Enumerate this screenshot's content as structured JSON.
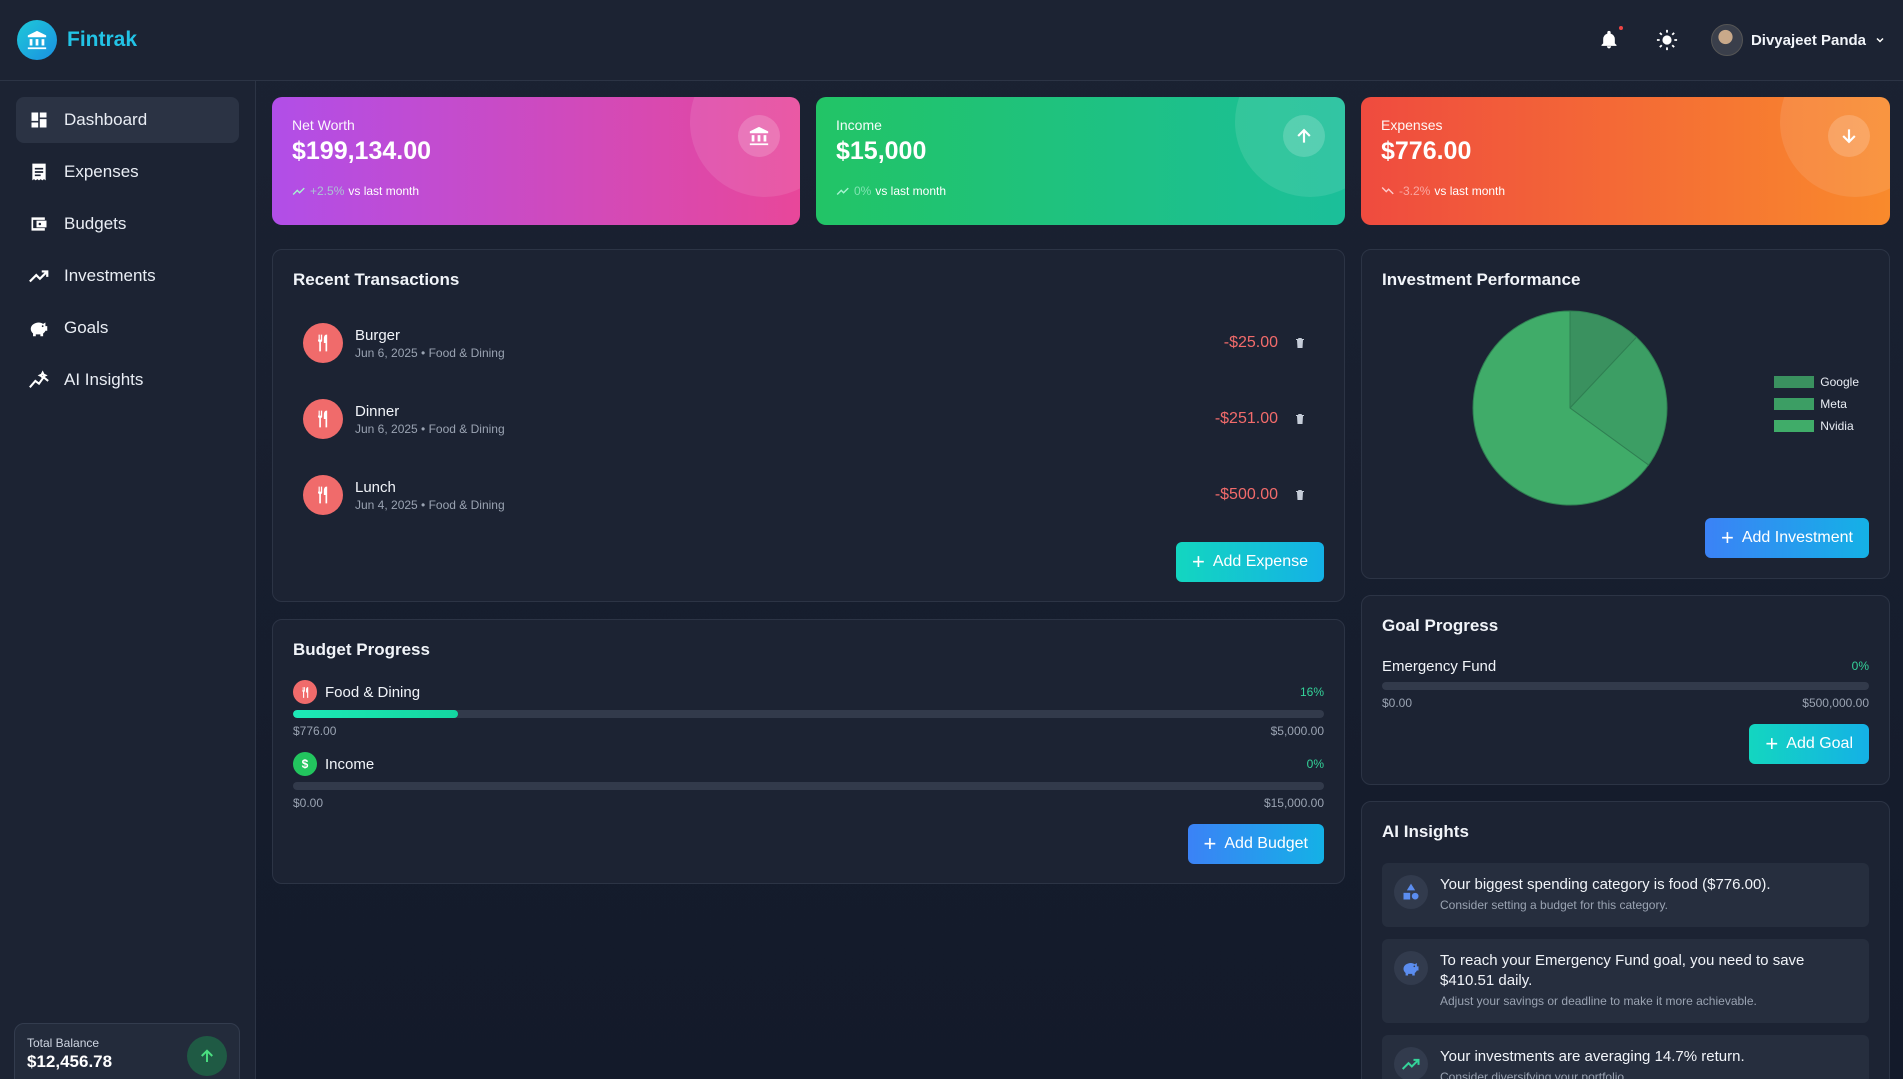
{
  "app": {
    "name": "Fintrak"
  },
  "header": {
    "user_name": "Divyajeet Panda"
  },
  "sidebar": {
    "items": [
      {
        "label": "Dashboard",
        "icon": "dashboard-icon",
        "active": true
      },
      {
        "label": "Expenses",
        "icon": "receipt-icon"
      },
      {
        "label": "Budgets",
        "icon": "wallet-icon"
      },
      {
        "label": "Investments",
        "icon": "trending-up-icon"
      },
      {
        "label": "Goals",
        "icon": "piggy-bank-icon"
      },
      {
        "label": "AI Insights",
        "icon": "sparkline-icon"
      }
    ],
    "total_balance": {
      "label": "Total Balance",
      "value": "$12,456.78"
    }
  },
  "stats": {
    "net_worth": {
      "label": "Net Worth",
      "value": "$199,134.00",
      "delta": "+2.5%",
      "suffix": "vs last month"
    },
    "income": {
      "label": "Income",
      "value": "$15,000",
      "delta": "0%",
      "suffix": "vs last month"
    },
    "expenses": {
      "label": "Expenses",
      "value": "$776.00",
      "delta": "-3.2%",
      "suffix": "vs last month"
    }
  },
  "transactions": {
    "title": "Recent Transactions",
    "items": [
      {
        "name": "Burger",
        "meta": "Jun 6, 2025 • Food & Dining",
        "amount": "-$25.00"
      },
      {
        "name": "Dinner",
        "meta": "Jun 6, 2025 • Food & Dining",
        "amount": "-$251.00"
      },
      {
        "name": "Lunch",
        "meta": "Jun 4, 2025 • Food & Dining",
        "amount": "-$500.00"
      }
    ],
    "add_label": "Add Expense"
  },
  "budget": {
    "title": "Budget Progress",
    "items": [
      {
        "name": "Food & Dining",
        "pct": "16%",
        "progress": 0.16,
        "spent": "$776.00",
        "limit": "$5,000.00",
        "icon": "utensils-icon",
        "color": "#f06b6b"
      },
      {
        "name": "Income",
        "pct": "0%",
        "progress": 0,
        "spent": "$0.00",
        "limit": "$15,000.00",
        "icon": "dollar-icon",
        "color": "#22c55e"
      }
    ],
    "add_label": "Add Budget"
  },
  "investment": {
    "title": "Investment Performance",
    "add_label": "Add Investment",
    "chart_data": {
      "type": "pie",
      "categories": [
        "Google",
        "Meta",
        "Nvidia"
      ],
      "values": [
        12,
        23,
        65
      ],
      "colors": [
        "#3a915f",
        "#3c9e64",
        "#40ac69"
      ],
      "legend": "right"
    }
  },
  "goals": {
    "title": "Goal Progress",
    "items": [
      {
        "name": "Emergency Fund",
        "pct": "0%",
        "progress": 0,
        "current": "$0.00",
        "target": "$500,000.00"
      }
    ],
    "add_label": "Add Goal"
  },
  "insights": {
    "title": "AI Insights",
    "items": [
      {
        "title": "Your biggest spending category is food ($776.00).",
        "sub": "Consider setting a budget for this category.",
        "icon": "shapes-icon"
      },
      {
        "title": "To reach your Emergency Fund goal, you need to save $410.51 daily.",
        "sub": "Adjust your savings or deadline to make it more achievable.",
        "icon": "piggy-bank-icon"
      },
      {
        "title": "Your investments are averaging 14.7% return.",
        "sub": "Consider diversifying your portfolio.",
        "icon": "trending-up-icon"
      }
    ]
  }
}
